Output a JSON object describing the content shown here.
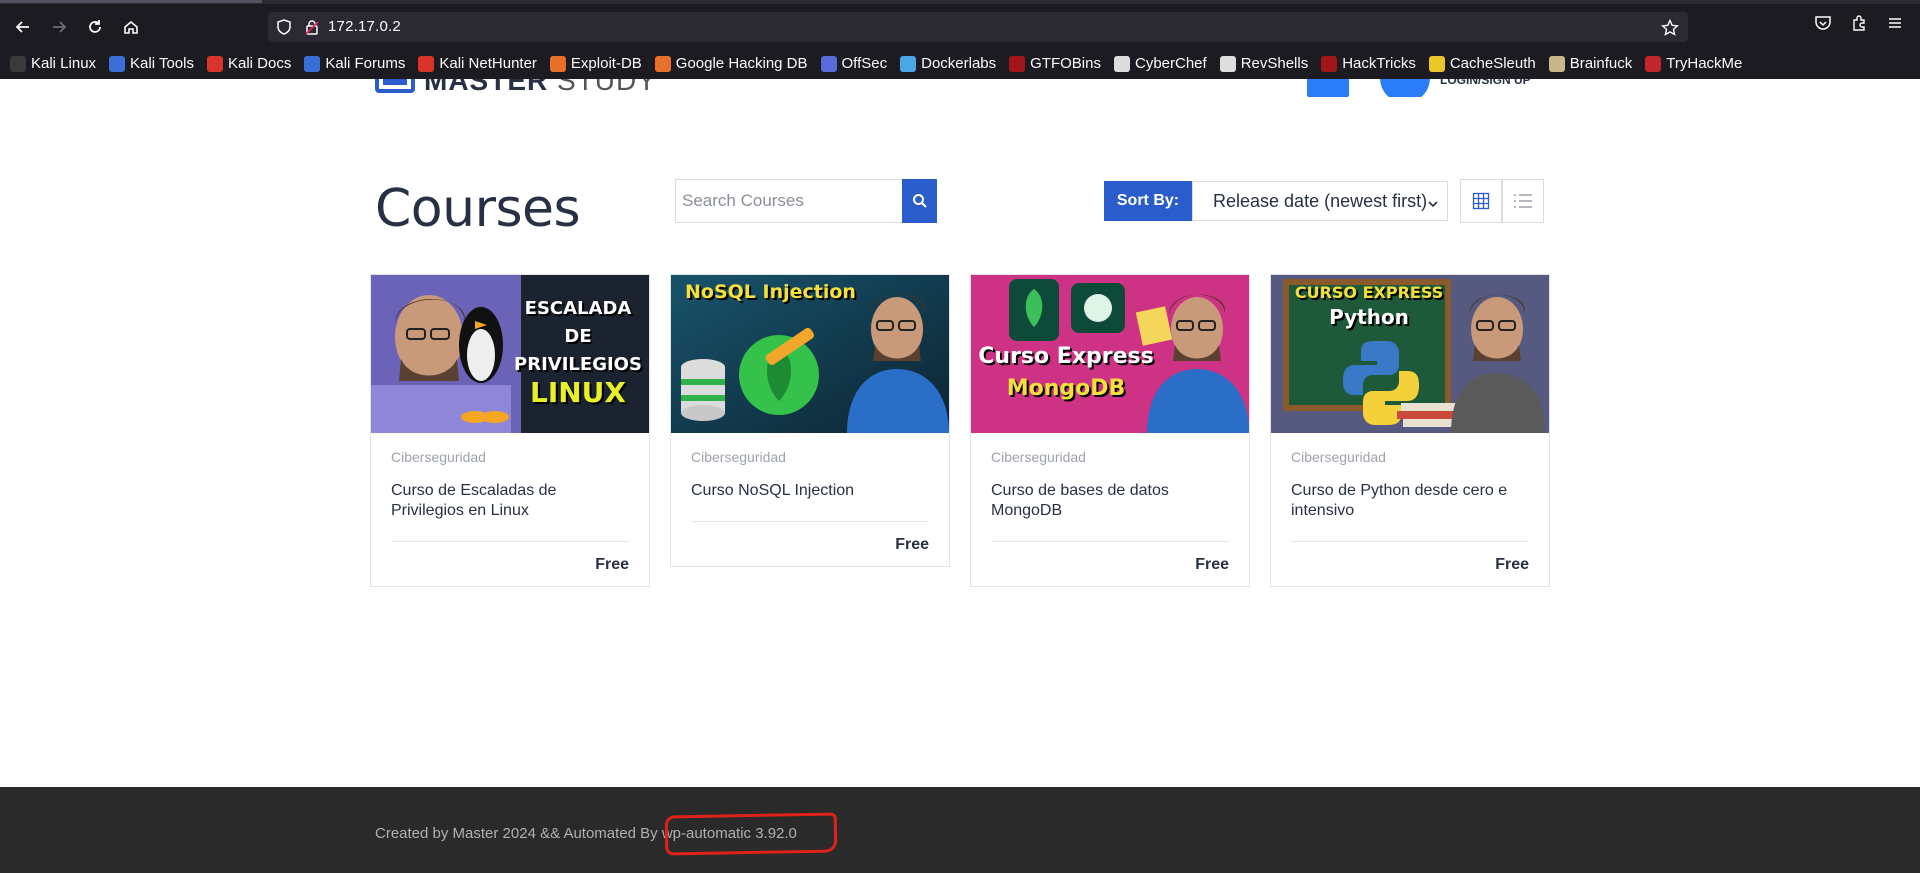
{
  "browser": {
    "url": "172.17.0.2",
    "bookmarks": [
      {
        "label": "Kali Linux",
        "icon": "kali-dragon-icon",
        "color": "#3a3a3a"
      },
      {
        "label": "Kali Tools",
        "icon": "kali-tools-icon",
        "color": "#3b6fd8"
      },
      {
        "label": "Kali Docs",
        "icon": "kali-docs-icon",
        "color": "#d8342a"
      },
      {
        "label": "Kali Forums",
        "icon": "kali-forums-icon",
        "color": "#3b6fd8"
      },
      {
        "label": "Kali NetHunter",
        "icon": "nethunter-icon",
        "color": "#d8342a"
      },
      {
        "label": "Exploit-DB",
        "icon": "exploit-db-icon",
        "color": "#e8702a"
      },
      {
        "label": "Google Hacking DB",
        "icon": "ghdb-icon",
        "color": "#e8702a"
      },
      {
        "label": "OffSec",
        "icon": "offsec-icon",
        "color": "#5a6ad8"
      },
      {
        "label": "Dockerlabs",
        "icon": "dockerlabs-icon",
        "color": "#4aa8e8"
      },
      {
        "label": "GTFOBins",
        "icon": "gtfobins-icon",
        "color": "#a0161a"
      },
      {
        "label": "CyberChef",
        "icon": "cyberchef-icon",
        "color": "#dddddd"
      },
      {
        "label": "RevShells",
        "icon": "skull-icon",
        "color": "#dddddd"
      },
      {
        "label": "HackTricks",
        "icon": "hacktricks-icon",
        "color": "#a0161a"
      },
      {
        "label": "CacheSleuth",
        "icon": "cachesleuth-icon",
        "color": "#e8c82a"
      },
      {
        "label": "Brainfuck",
        "icon": "brainfuck-icon",
        "color": "#c8b888"
      },
      {
        "label": "TryHackMe",
        "icon": "tryhackme-icon",
        "color": "#c0262a"
      }
    ]
  },
  "header": {
    "logo_bold": "MASTER",
    "logo_light": " STUDY",
    "login_label": "LOGIN/SIGN UP"
  },
  "main": {
    "title": "Courses",
    "search_placeholder": "Search Courses",
    "sort_label": "Sort By:",
    "sort_value": "Release date (newest first)"
  },
  "courses": [
    {
      "category": "Ciberseguridad",
      "title": "Curso de Escaladas de Privilegios en Linux",
      "price": "Free",
      "thumb_text": [
        "ESCALADA DE",
        "PRIVILEGIOS",
        "LINUX"
      ]
    },
    {
      "category": "Ciberseguridad",
      "title": "Curso NoSQL Injection",
      "price": "Free",
      "thumb_text": [
        "NoSQL Injection"
      ]
    },
    {
      "category": "Ciberseguridad",
      "title": "Curso de bases de datos MongoDB",
      "price": "Free",
      "thumb_text": [
        "Curso Express",
        "MongoDB"
      ]
    },
    {
      "category": "Ciberseguridad",
      "title": "Curso de Python desde cero e intensivo",
      "price": "Free",
      "thumb_text": [
        "CURSO EXPRESS",
        "Python"
      ]
    }
  ],
  "footer": {
    "prefix": "Created by Master 2024 && Automated By ",
    "plugin": "wp-automatic 3.92.0"
  },
  "colors": {
    "accent": "#2a5ccc",
    "annotation": "#e0211a"
  }
}
